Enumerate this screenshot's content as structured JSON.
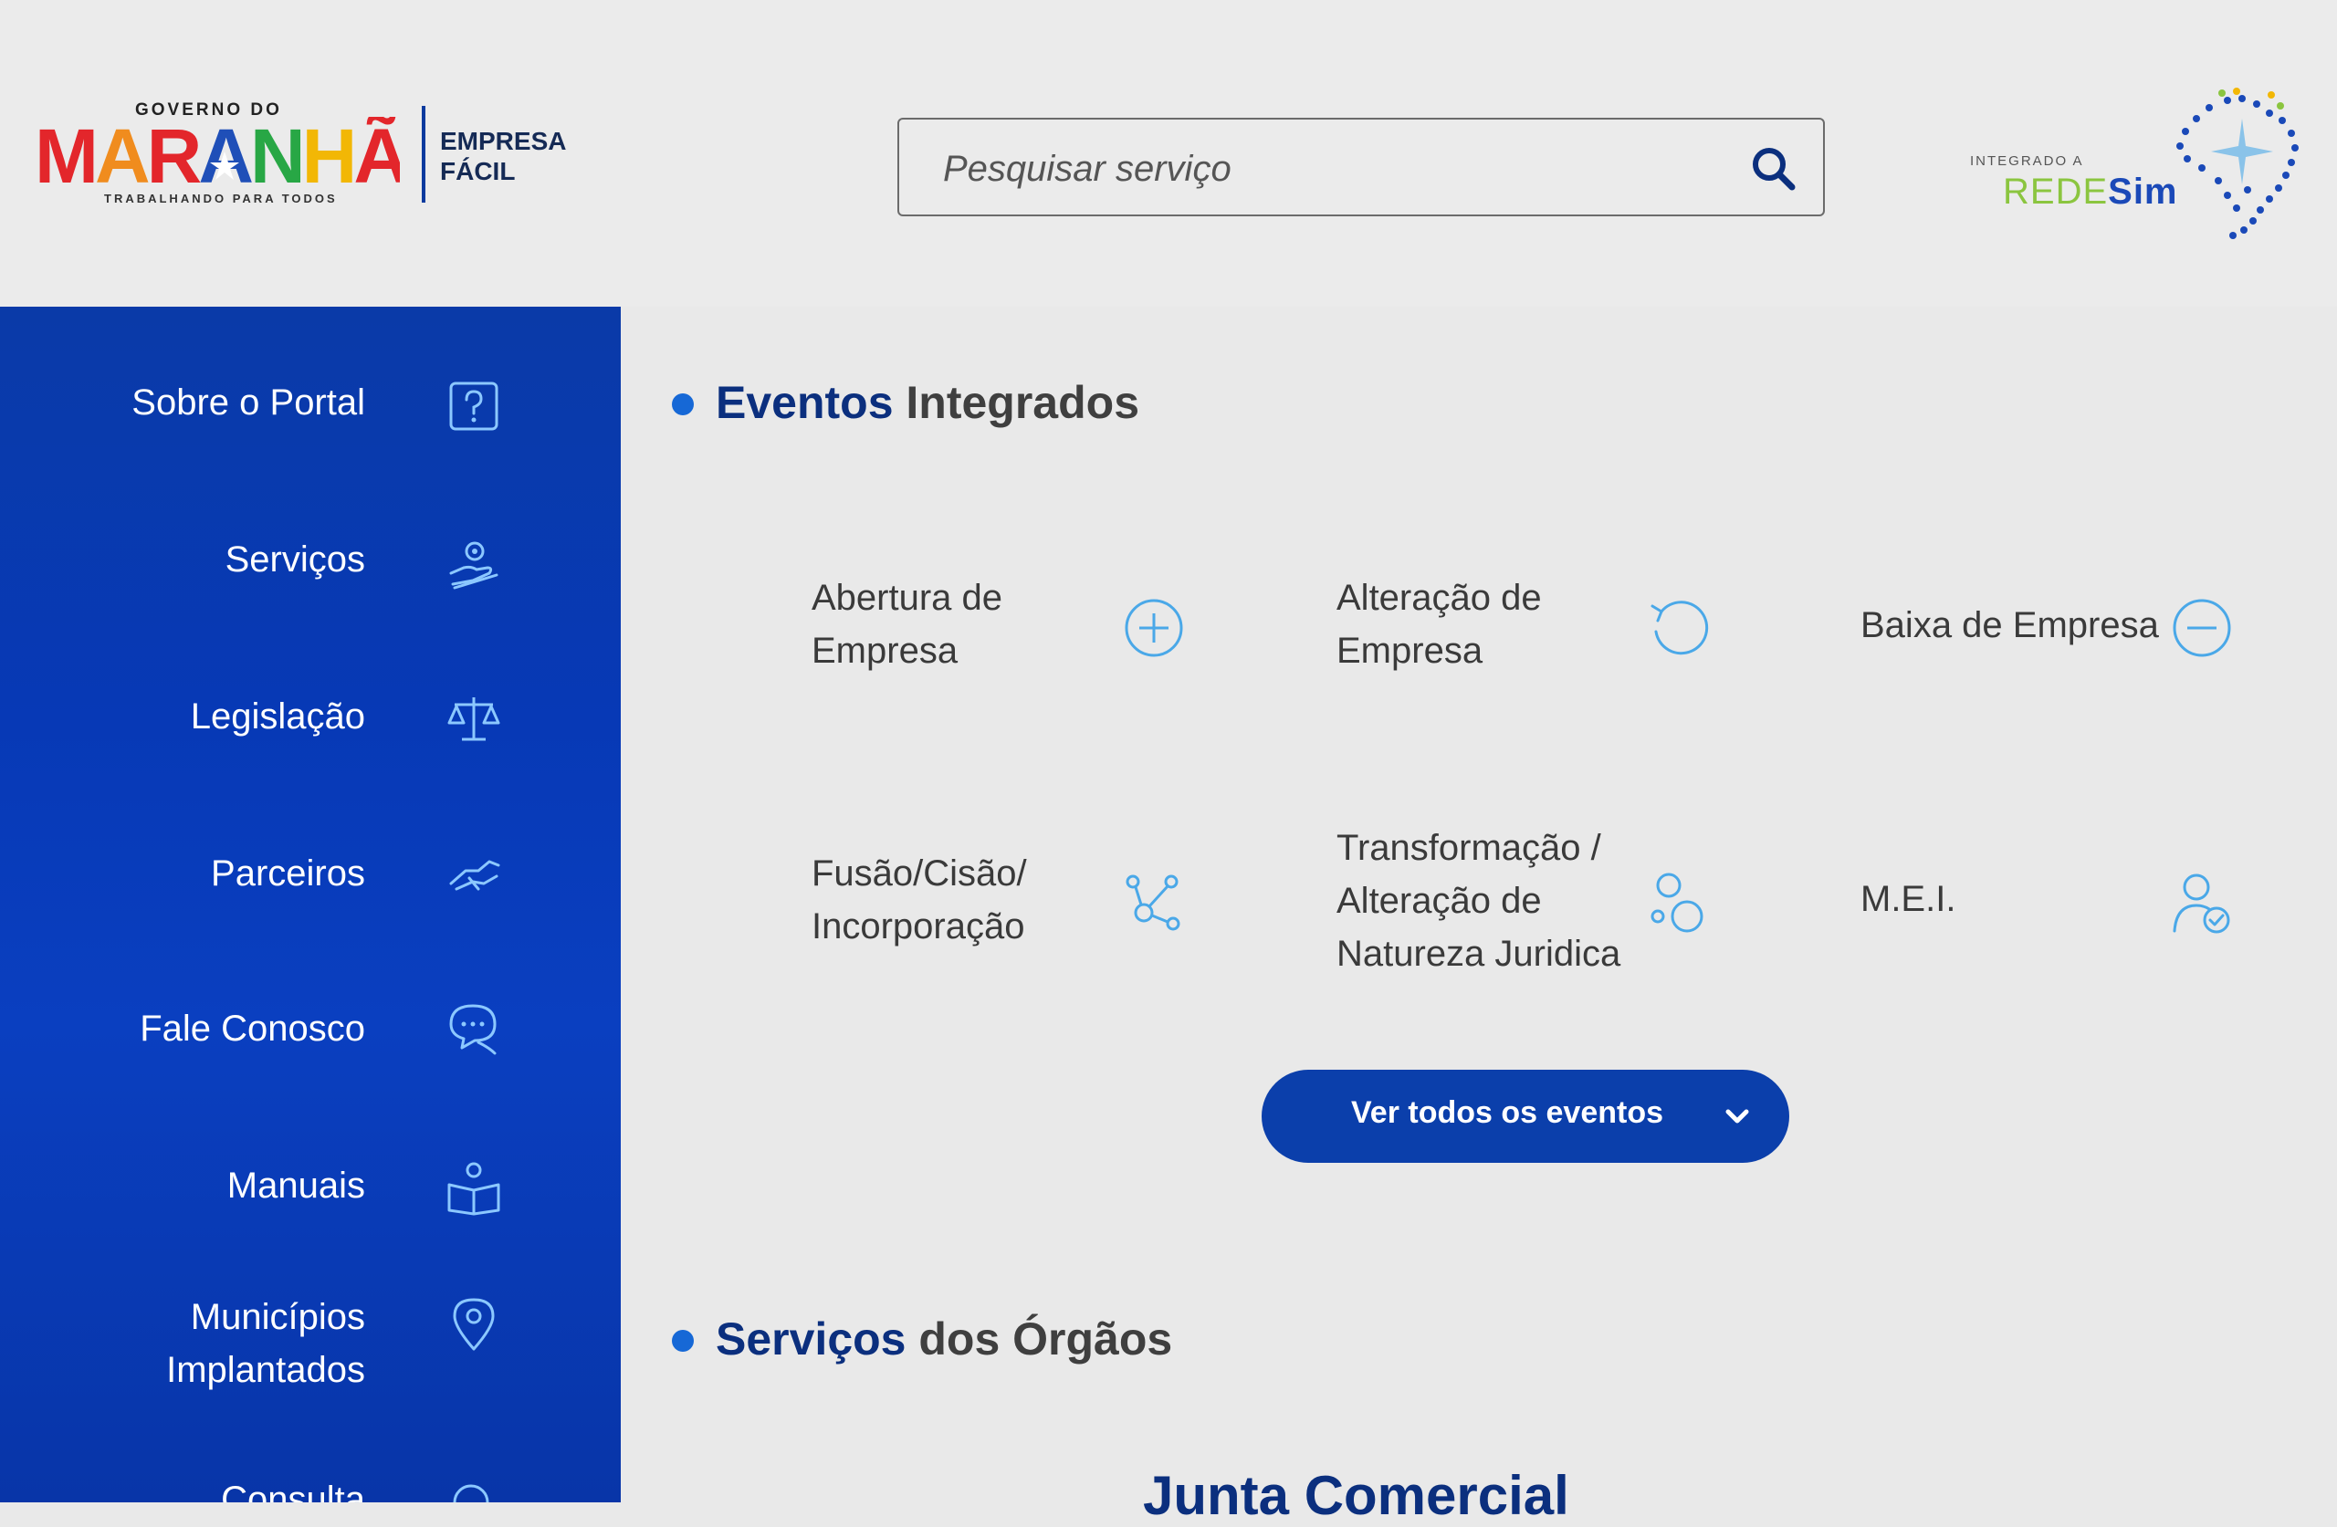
{
  "header": {
    "brand": {
      "top": "GOVERNO DO",
      "word": "MARANHÃO",
      "sub": "TRABALHANDO PARA TODOS",
      "product_line1": "EMPRESA",
      "product_line2": "FÁCIL"
    },
    "search": {
      "placeholder": "Pesquisar serviço",
      "value": ""
    },
    "redesim": {
      "small": "INTEGRADO A",
      "word_a": "REDE",
      "word_b": "Sim"
    }
  },
  "sidebar": {
    "items": [
      {
        "label": "Sobre o Portal",
        "icon": "question-square-icon"
      },
      {
        "label": "Serviços",
        "icon": "hand-gear-icon"
      },
      {
        "label": "Legislação",
        "icon": "scales-icon"
      },
      {
        "label": "Parceiros",
        "icon": "handshake-icon"
      },
      {
        "label": "Fale Conosco",
        "icon": "chat-bubbles-icon"
      },
      {
        "label": "Manuais",
        "icon": "book-person-icon"
      },
      {
        "label_line1": "Municípios",
        "label_line2": "Implantados",
        "icon": "map-pin-icon"
      },
      {
        "label": "Consulta",
        "icon": "search-icon"
      }
    ]
  },
  "eventos": {
    "title_strong": "Eventos",
    "title_rest": " Integrados",
    "items": [
      {
        "line1": "Abertura de",
        "line2": "Empresa",
        "icon": "plus-circle-icon"
      },
      {
        "line1": "Alteração de",
        "line2": "Empresa",
        "icon": "refresh-icon"
      },
      {
        "line1": "Baixa de Empresa",
        "icon": "minus-circle-icon"
      },
      {
        "line1": "Fusão/Cisão/",
        "line2": "Incorporação",
        "icon": "nodes-icon"
      },
      {
        "line1": "Transformação /",
        "line2": "Alteração de",
        "line3": "Natureza Juridica",
        "icon": "bubbles-icon"
      },
      {
        "line1": "M.E.I.",
        "icon": "user-check-icon"
      }
    ],
    "button": "Ver todos os eventos"
  },
  "servicos": {
    "title_strong": "Serviços",
    "title_rest": " dos Órgãos",
    "first_card": "Junta Comercial"
  },
  "colors": {
    "sidebar": "#0739b6",
    "accent": "#1668d6",
    "dark_blue": "#0b2f7e",
    "button": "#0b3fab",
    "icon_light": "#4aa8e8"
  }
}
